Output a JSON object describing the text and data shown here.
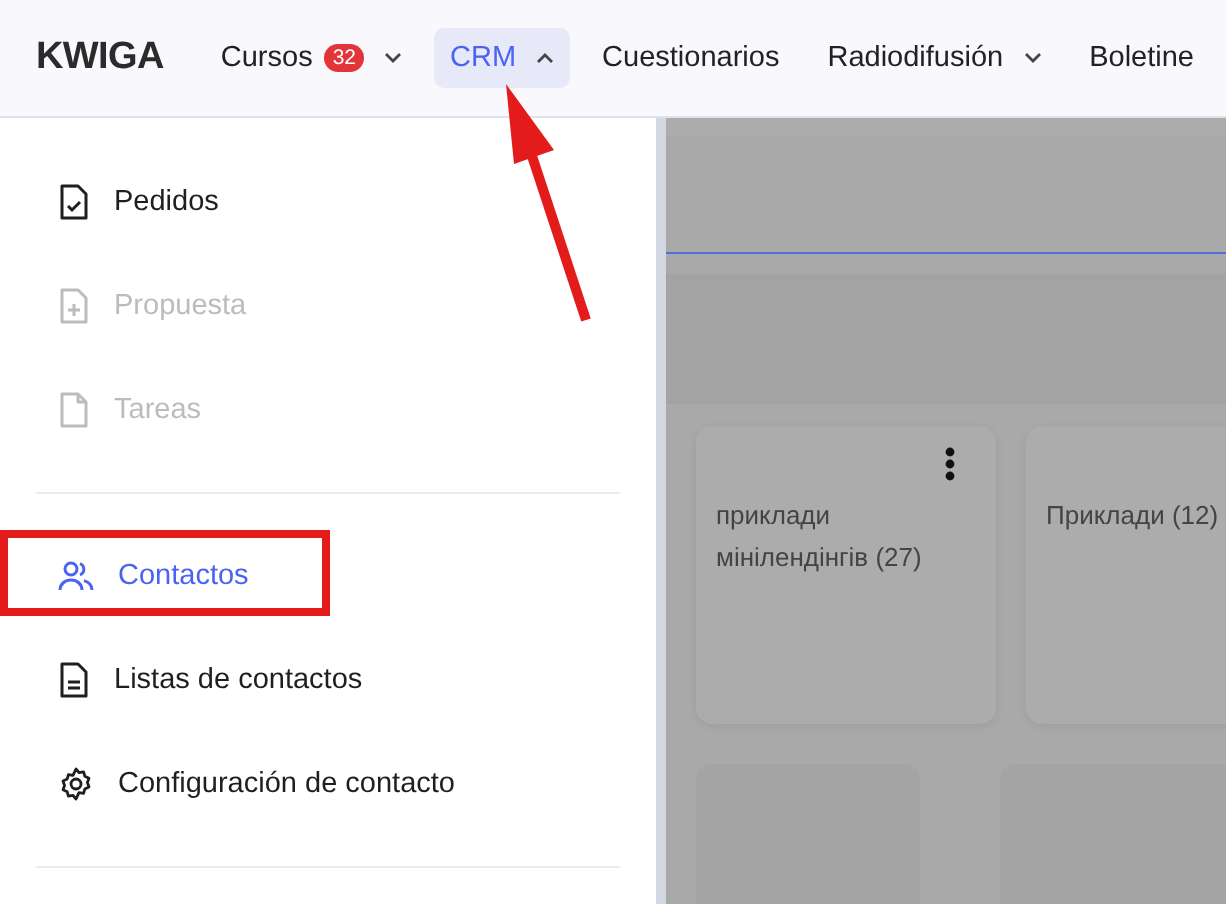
{
  "brand": "KWIGA",
  "nav": [
    {
      "label": "Cursos",
      "badge": "32",
      "expanded": false,
      "selected": false
    },
    {
      "label": "CRM",
      "expanded": true,
      "selected": true
    },
    {
      "label": "Cuestionarios",
      "selected": false
    },
    {
      "label": "Radiodifusión",
      "expanded": false,
      "selected": false
    },
    {
      "label": "Boletine",
      "selected": false
    }
  ],
  "menu": [
    [
      {
        "label": "Pedidos",
        "disabled": false,
        "selected": false
      },
      {
        "label": "Propuesta",
        "disabled": true,
        "selected": false
      },
      {
        "label": "Tareas",
        "disabled": true,
        "selected": false
      }
    ],
    [
      {
        "label": "Contactos",
        "disabled": false,
        "selected": true
      },
      {
        "label": "Listas de contactos",
        "disabled": false,
        "selected": false
      },
      {
        "label": "Configuración de contacto",
        "disabled": false,
        "selected": false
      }
    ]
  ],
  "cards": [
    {
      "title": "приклади мінілендінгів (27)",
      "menu": true
    },
    {
      "title": "Приклади (12)"
    }
  ]
}
